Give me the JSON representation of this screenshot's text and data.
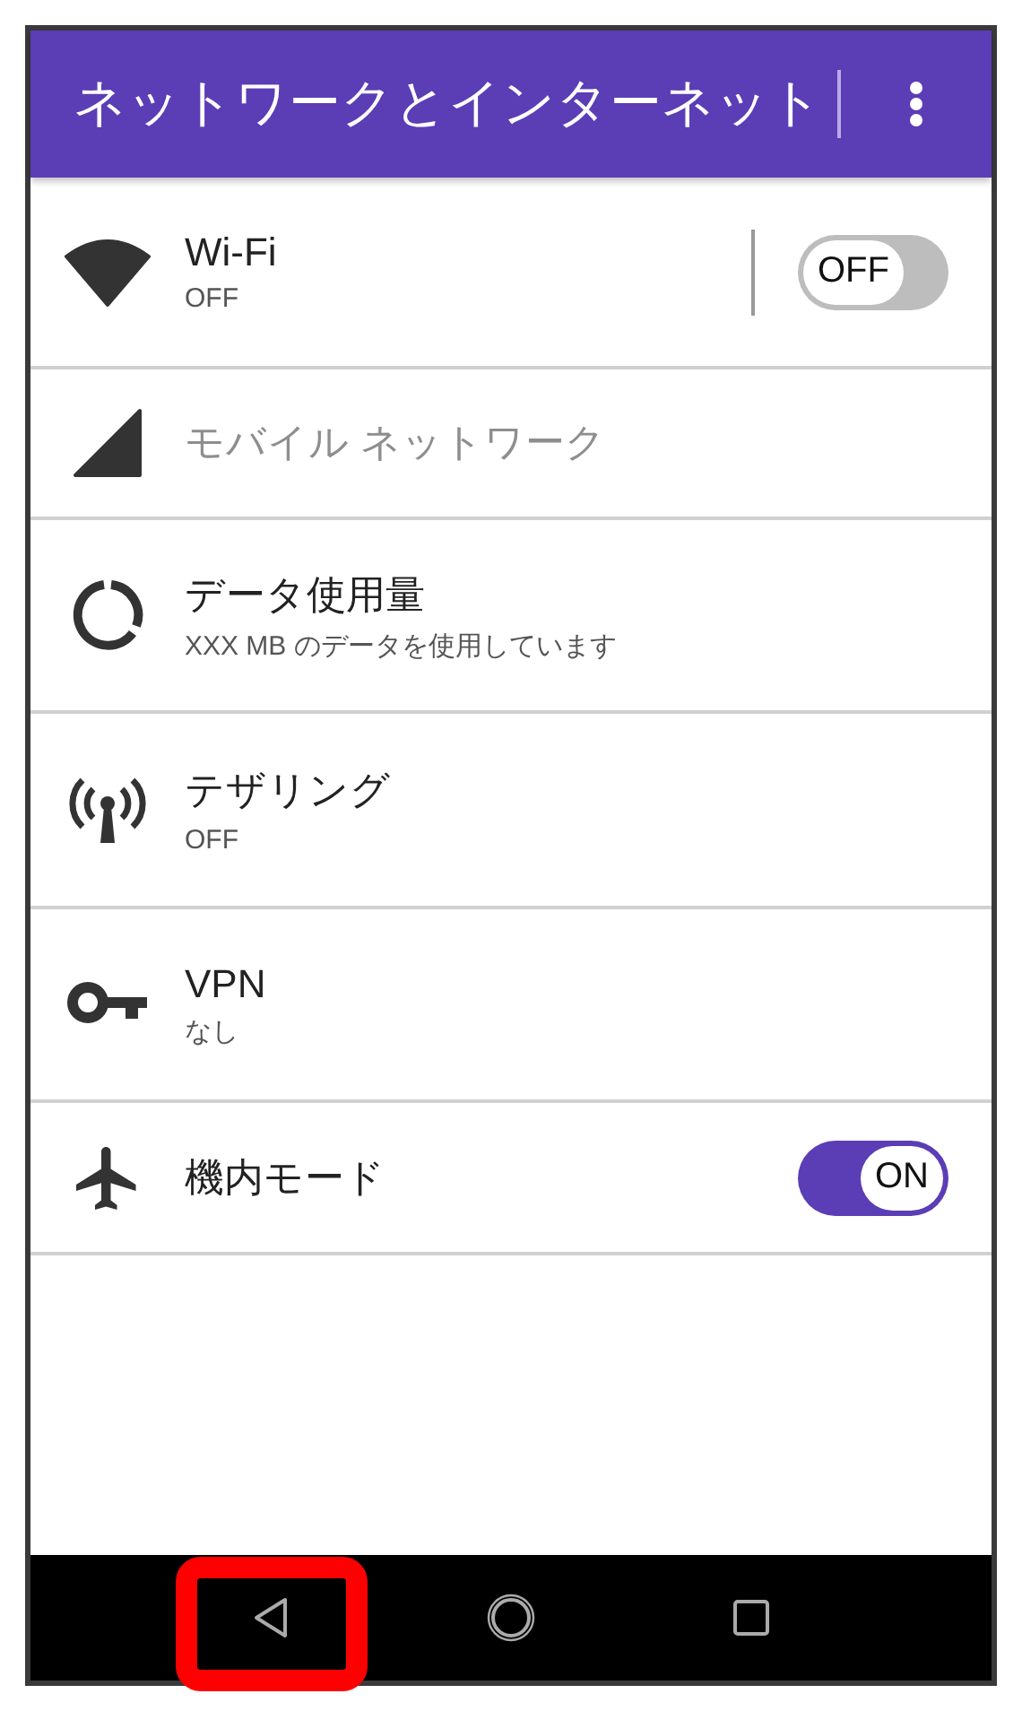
{
  "header": {
    "title": "ネットワークとインターネット"
  },
  "items": [
    {
      "kind": "switch",
      "title": "Wi-Fi",
      "subtitle": "OFF",
      "disabled": false,
      "divider": true,
      "switch": {
        "on": false,
        "label": "OFF"
      }
    },
    {
      "kind": "plain",
      "title": "モバイル ネットワーク",
      "disabled": true
    },
    {
      "kind": "plain",
      "title": "データ使用量",
      "subtitle": "XXX MB のデータを使用しています",
      "disabled": false
    },
    {
      "kind": "plain",
      "title": "テザリング",
      "subtitle": "OFF",
      "disabled": false
    },
    {
      "kind": "plain",
      "title": "VPN",
      "subtitle": "なし",
      "disabled": false
    },
    {
      "kind": "switch",
      "title": "機内モード",
      "disabled": false,
      "divider": false,
      "switch": {
        "on": true,
        "label": "ON"
      }
    }
  ],
  "nav_buttons": [
    {
      "highlighted": true
    },
    {
      "highlighted": false
    },
    {
      "highlighted": false
    }
  ]
}
